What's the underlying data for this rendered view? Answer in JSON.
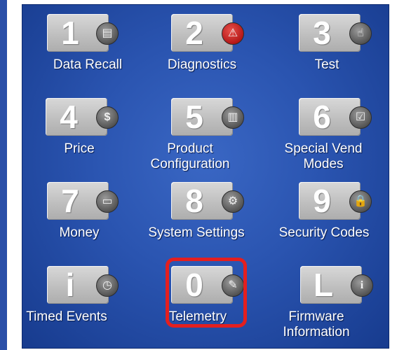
{
  "buttons": [
    {
      "key": "1",
      "label": "Data Recall",
      "icon": "notepad-icon",
      "glyph": "▤"
    },
    {
      "key": "2",
      "label": "Diagnostics",
      "icon": "warning-icon",
      "glyph": "⚠"
    },
    {
      "key": "3",
      "label": "Test",
      "icon": "hand-pointer-icon",
      "glyph": "☝"
    },
    {
      "key": "4",
      "label": "Price",
      "icon": "dollar-icon",
      "glyph": "$"
    },
    {
      "key": "5",
      "label": "Product Configuration",
      "icon": "product-columns-icon",
      "glyph": "▥"
    },
    {
      "key": "6",
      "label": "Special Vend Modes",
      "icon": "checkbox-icon",
      "glyph": "☑"
    },
    {
      "key": "7",
      "label": "Money",
      "icon": "banknote-icon",
      "glyph": "▭"
    },
    {
      "key": "8",
      "label": "System Settings",
      "icon": "gear-icon",
      "glyph": "⚙"
    },
    {
      "key": "9",
      "label": "Security Codes",
      "icon": "lock-icon",
      "glyph": "🔒"
    },
    {
      "key": "i",
      "label": "Timed Events",
      "icon": "stopwatch-icon",
      "glyph": "◷"
    },
    {
      "key": "0",
      "label": "Telemetry",
      "icon": "satellite-dish-icon",
      "glyph": "✎"
    },
    {
      "key": "L",
      "label": "Firmware Information",
      "icon": "info-icon",
      "glyph": "i"
    }
  ],
  "highlighted_key": "0",
  "colors": {
    "panel": "#2a54b0",
    "highlight": "#e41f1f",
    "key": "#c4c4c4"
  }
}
